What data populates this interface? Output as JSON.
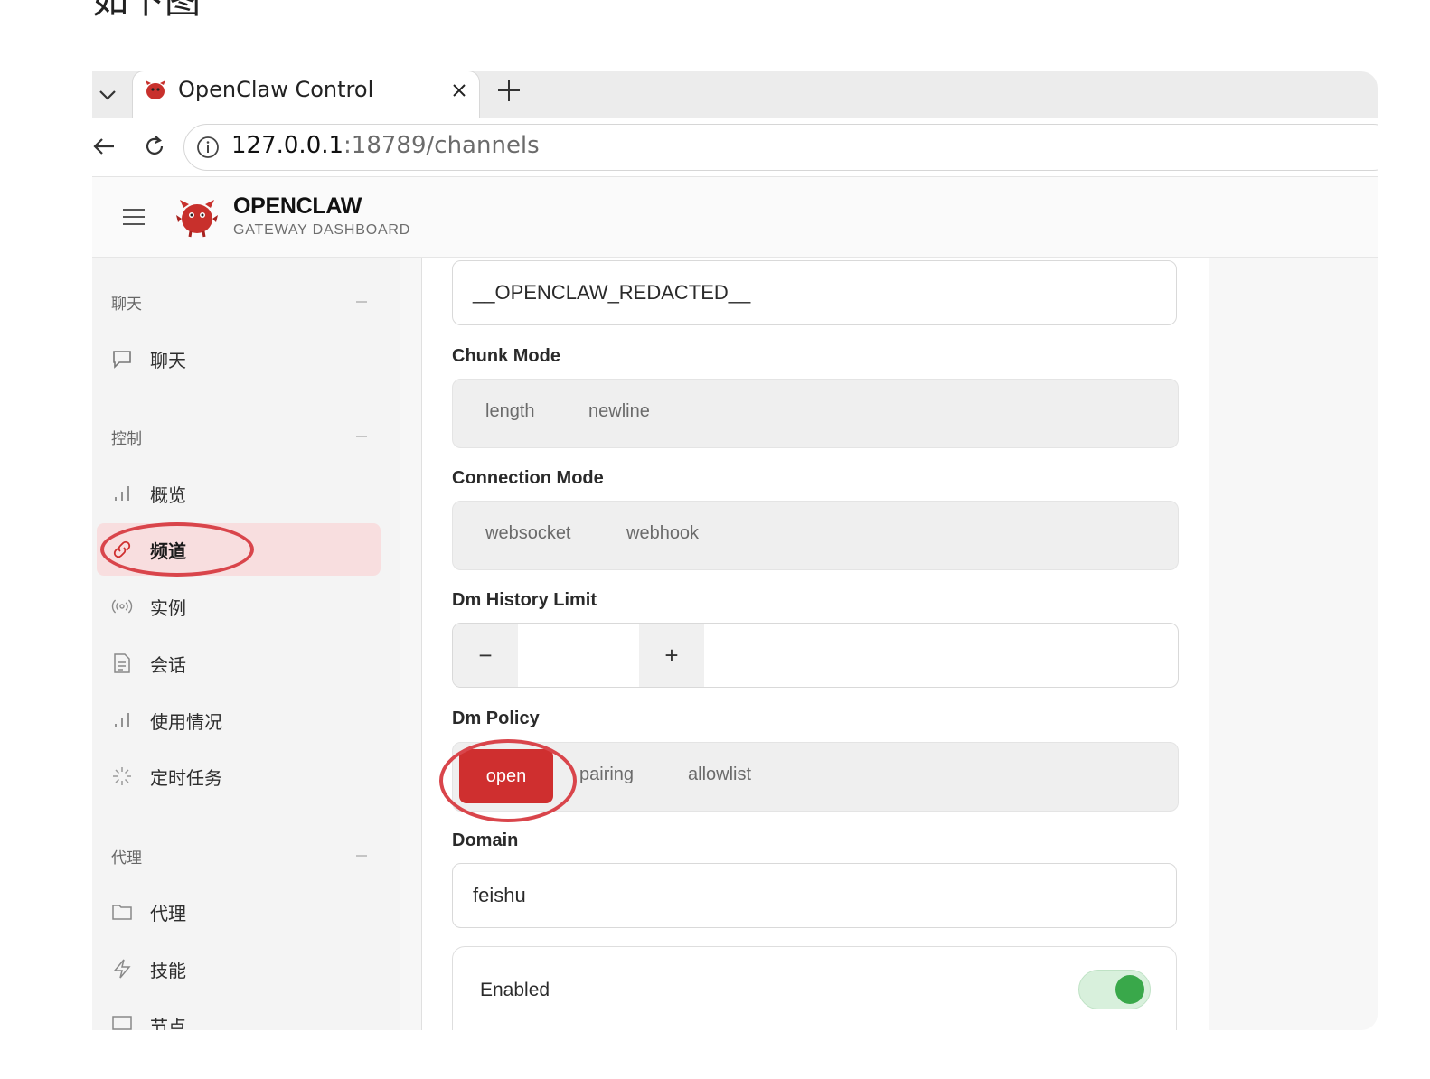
{
  "caption": "如下图",
  "browser": {
    "tab_title": "OpenClaw Control",
    "close_glyph": "×",
    "new_tab_glyph": "+",
    "url_host": "127.0.0.1",
    "url_path": ":18789/channels"
  },
  "header": {
    "brand_title": "OPENCLAW",
    "brand_subtitle": "GATEWAY DASHBOARD"
  },
  "sidebar": {
    "groups": [
      {
        "label": "聊天",
        "items": [
          {
            "label": "聊天",
            "icon": "message-icon"
          }
        ]
      },
      {
        "label": "控制",
        "items": [
          {
            "label": "概览",
            "icon": "bar-chart-icon"
          },
          {
            "label": "频道",
            "icon": "link-icon",
            "active": true
          },
          {
            "label": "实例",
            "icon": "broadcast-icon"
          },
          {
            "label": "会话",
            "icon": "document-icon"
          },
          {
            "label": "使用情况",
            "icon": "bar-chart-icon"
          },
          {
            "label": "定时任务",
            "icon": "loader-icon"
          }
        ]
      },
      {
        "label": "代理",
        "items": [
          {
            "label": "代理",
            "icon": "folder-icon"
          },
          {
            "label": "技能",
            "icon": "zap-icon"
          },
          {
            "label": "节点",
            "icon": "monitor-icon"
          }
        ]
      }
    ]
  },
  "form": {
    "token_value": "__OPENCLAW_REDACTED__",
    "chunk_mode": {
      "label": "Chunk Mode",
      "options": [
        "length",
        "newline"
      ]
    },
    "connection_mode": {
      "label": "Connection Mode",
      "options": [
        "websocket",
        "webhook"
      ]
    },
    "dm_history_limit": {
      "label": "Dm History Limit",
      "minus": "−",
      "plus": "+",
      "value": ""
    },
    "dm_policy": {
      "label": "Dm Policy",
      "options": [
        "open",
        "pairing",
        "allowlist"
      ],
      "selected": "open"
    },
    "domain": {
      "label": "Domain",
      "value": "feishu"
    },
    "enabled": {
      "label": "Enabled",
      "on": true
    }
  },
  "colors": {
    "accent": "#cf2f2f",
    "active_nav_bg": "#f8dedf",
    "annotation": "#d9454b",
    "toggle_on": "#39a84a"
  }
}
